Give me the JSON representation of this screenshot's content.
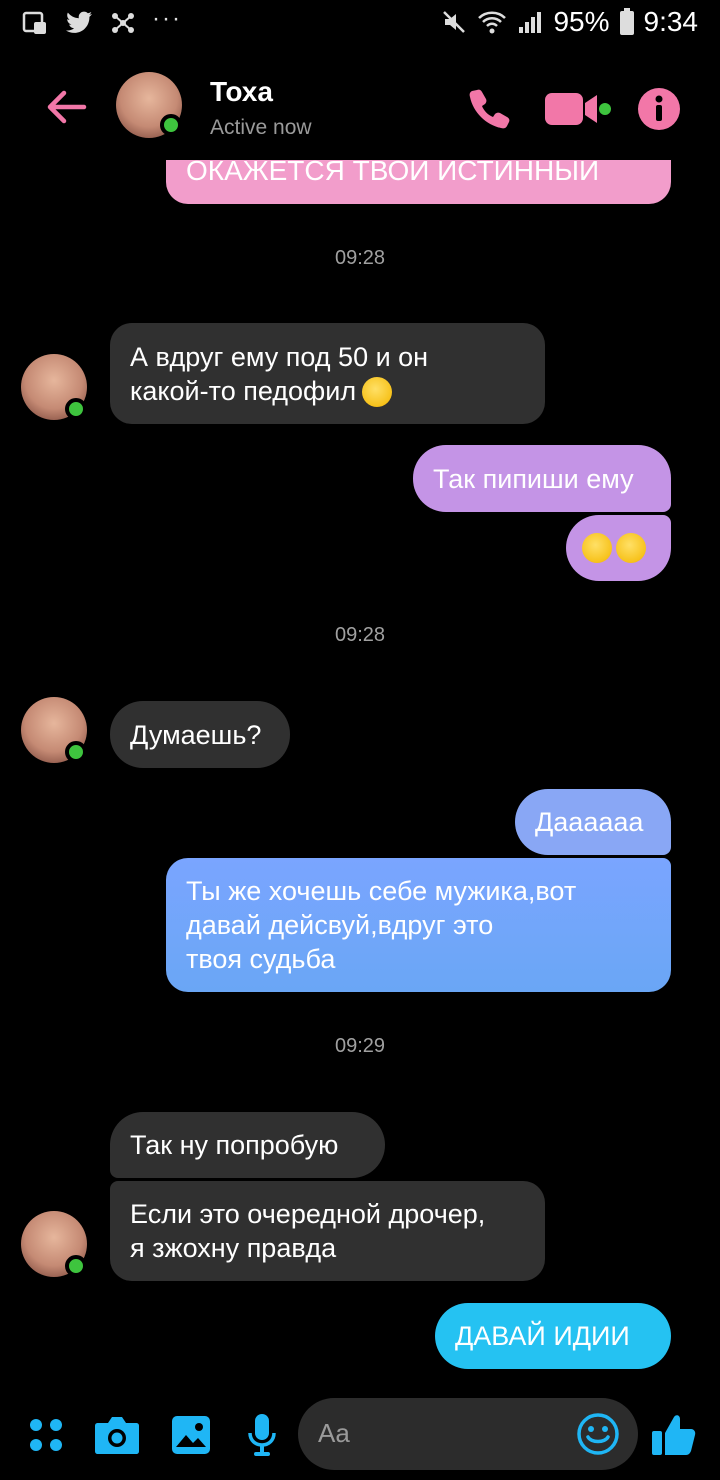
{
  "status_bar": {
    "battery": "95%",
    "time": "9:34",
    "left_icons": [
      "notification-icon",
      "twitter-icon",
      "network-icon"
    ],
    "more": "···"
  },
  "header": {
    "name": "Тоха",
    "status": "Active now",
    "accent": "#f277a8"
  },
  "messages": {
    "partial_top": "ОКАЖЕТСЯ ТВОЙ ИСТИННЫЙ",
    "ts1": "09:28",
    "m1_line1": "А вдруг ему под 50 и он",
    "m1_line2": "какой-то педофил",
    "m2": "Так пипиши ему",
    "ts2": "09:28",
    "m3": "Думаешь?",
    "m4": "Даааааа",
    "m5_line1": "Ты же хочешь себе мужика,вот",
    "m5_line2": "давай дейсвуй,вдруг это",
    "m5_line3": "твоя судьба",
    "ts3": "09:29",
    "m6": "Так ну попробую",
    "m7_line1": "Если это очередной дрочер,",
    "m7_line2": "я зжохну правда",
    "m8": "ДАВАЙ ИДИИ"
  },
  "composer": {
    "placeholder": "Aa",
    "accent": "#1fb6f5"
  }
}
